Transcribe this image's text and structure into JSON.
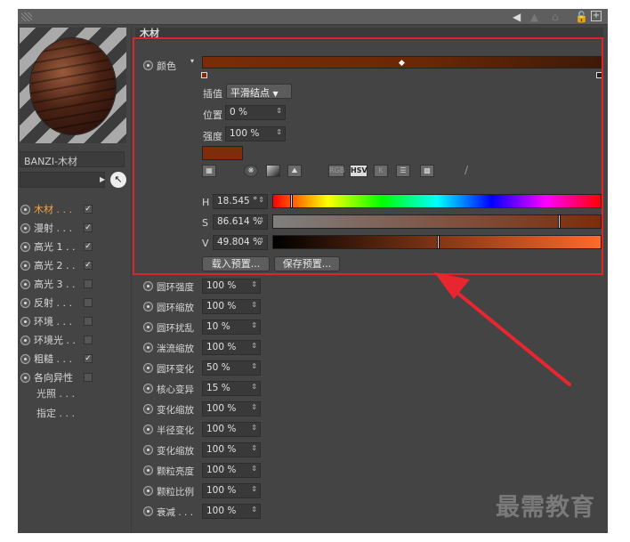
{
  "toolbar": {
    "back_icon": "back-arrow-icon",
    "lock_icon": "lock-icon",
    "expand_icon": "expand-icon"
  },
  "material": {
    "name": "BANZI-木材"
  },
  "channels": [
    {
      "label": "木材 . . .",
      "checked": true,
      "active": true
    },
    {
      "label": "漫射 . . .",
      "checked": true
    },
    {
      "label": "高光 1 . .",
      "checked": true
    },
    {
      "label": "高光 2 . .",
      "checked": true
    },
    {
      "label": "高光 3 . .",
      "checked": false
    },
    {
      "label": "反射 . . .",
      "checked": false
    },
    {
      "label": "环境 . . .",
      "checked": false
    },
    {
      "label": "环境光 . .",
      "checked": false
    },
    {
      "label": "粗糙 . . .",
      "checked": true
    },
    {
      "label": "各向异性",
      "checked": false
    }
  ],
  "sub_items": [
    "光照 . . .",
    "指定 . . ."
  ],
  "section": {
    "title": "木材"
  },
  "color": {
    "label": "颜色",
    "interp_label": "插值",
    "interp_value": "平滑结点",
    "pos_label": "位置",
    "pos_value": "0 %",
    "strength_label": "强度",
    "strength_value": "100 %",
    "swatch": "#7f2c0b",
    "mode_icons": [
      "RGB",
      "HSV",
      "K"
    ],
    "h_label": "H",
    "h_value": "18.545 °",
    "s_label": "S",
    "s_value": "86.614 %",
    "v_label": "V",
    "v_value": "49.804 %",
    "h": 0.0515,
    "s": 0.86614,
    "v": 0.49804
  },
  "buttons": {
    "load": "载入预置...",
    "save": "保存预置..."
  },
  "params": [
    {
      "label": "圆环强度",
      "value": "100 %"
    },
    {
      "label": "圆环缩放",
      "value": "100 %"
    },
    {
      "label": "圆环扰乱",
      "value": "10 %"
    },
    {
      "label": "湍流缩放",
      "value": "100 %"
    },
    {
      "label": "圆环变化",
      "value": "50 %"
    },
    {
      "label": "核心变异",
      "value": "15 %"
    },
    {
      "label": "变化缩放",
      "value": "100 %"
    },
    {
      "label": "半径变化",
      "value": "100 %"
    },
    {
      "label": "变化缩放",
      "value": "100 %"
    },
    {
      "label": "颗粒亮度",
      "value": "100 %"
    },
    {
      "label": "颗粒比例",
      "value": "100 %"
    },
    {
      "label": "衰减 . . .",
      "value": "100 %"
    }
  ],
  "watermark": "最需教育",
  "colors": {
    "highlight": "#d8262e",
    "accent": "#f2a545"
  }
}
